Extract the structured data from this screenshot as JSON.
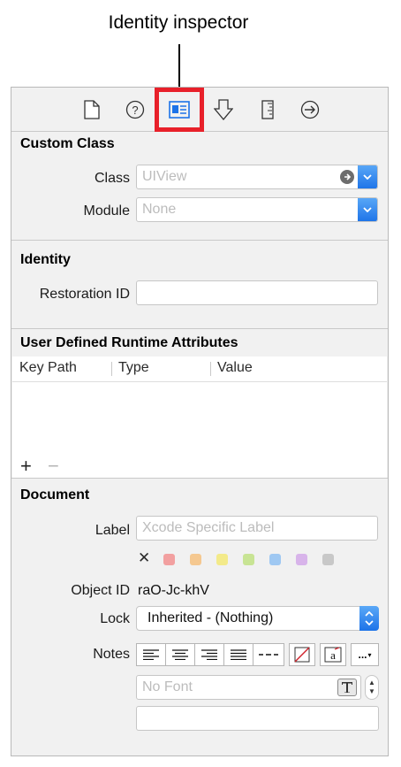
{
  "callout": {
    "title": "Identity inspector"
  },
  "toolbar": {
    "icons": [
      "file-inspector-icon",
      "quick-help-icon",
      "identity-inspector-icon",
      "attributes-inspector-icon",
      "size-inspector-icon",
      "connections-inspector-icon"
    ],
    "selected": "identity-inspector-icon",
    "highlight_color": "#e8202a"
  },
  "custom_class": {
    "title": "Custom Class",
    "class_label": "Class",
    "class_placeholder": "UIView",
    "module_label": "Module",
    "module_placeholder": "None"
  },
  "identity": {
    "title": "Identity",
    "restoration_id_label": "Restoration ID",
    "restoration_id_value": ""
  },
  "runtime_attributes": {
    "title": "User Defined Runtime Attributes",
    "columns": [
      "Key Path",
      "Type",
      "Value"
    ],
    "rows": [],
    "add_label": "+",
    "remove_label": "−"
  },
  "document": {
    "title": "Document",
    "label_label": "Label",
    "label_placeholder": "Xcode Specific Label",
    "clear_color_symbol": "✕",
    "color_tags": [
      "#f2a0a0",
      "#f5c890",
      "#f3ea8a",
      "#c8e494",
      "#9fc8f2",
      "#d8b4ea",
      "#c8c8c8"
    ],
    "object_id_label": "Object ID",
    "object_id_value": "raO-Jc-khV",
    "lock_label": "Lock",
    "lock_value": "Inherited - (Nothing)",
    "notes_label": "Notes",
    "notes_buttons": [
      "align-left-icon",
      "align-center-icon",
      "align-right-icon",
      "align-justify-icon",
      "align-natural-icon",
      "text-color-icon",
      "background-color-icon",
      "more-options-icon"
    ],
    "more_label": "...",
    "font_placeholder": "No Font",
    "notes_text": ""
  },
  "accent_color": "#1d73e8"
}
